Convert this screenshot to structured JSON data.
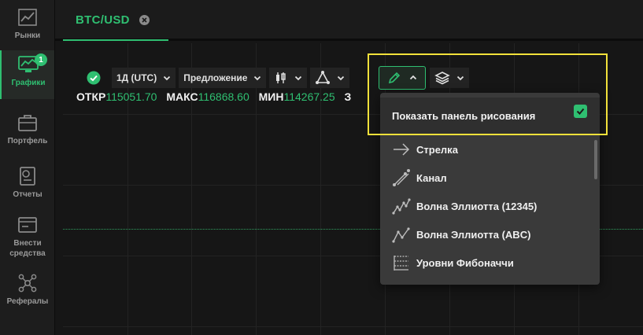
{
  "sidebar": {
    "items": [
      {
        "label": "Рынки",
        "icon": "trend-icon"
      },
      {
        "label": "Графики",
        "icon": "chart-monitor-icon",
        "badge": "1",
        "active": true
      },
      {
        "label": "Портфель",
        "icon": "briefcase-icon"
      },
      {
        "label": "Отчеты",
        "icon": "report-icon"
      },
      {
        "label": "Внести средства",
        "icon": "deposit-icon"
      },
      {
        "label": "Рефералы",
        "icon": "network-icon"
      }
    ]
  },
  "tab": {
    "title": "BTC/USD"
  },
  "toolbar": {
    "interval_label": "1Д (UTC)",
    "price_type_label": "Предложение"
  },
  "ohlc": {
    "open_key": "ОТКР",
    "open_val": "115051.70",
    "high_key": "МАКС",
    "high_val": "116868.60",
    "low_key": "МИН",
    "low_val": "114267.25",
    "close_key": "З"
  },
  "dropdown": {
    "header_label": "Показать панель рисования",
    "header_checked": true,
    "items": [
      {
        "label": "Стрелка",
        "icon": "arrow-right-icon"
      },
      {
        "label": "Канал",
        "icon": "channel-icon"
      },
      {
        "label": "Волна Эллиотта (12345)",
        "icon": "elliott-impulse-icon"
      },
      {
        "label": "Волна Эллиотта (ABC)",
        "icon": "elliott-correction-icon"
      },
      {
        "label": "Уровни Фибоначчи",
        "icon": "fibonacci-icon"
      }
    ]
  },
  "colors": {
    "accent": "#2fbf71",
    "highlight": "#f2e13a",
    "background": "#161616"
  }
}
